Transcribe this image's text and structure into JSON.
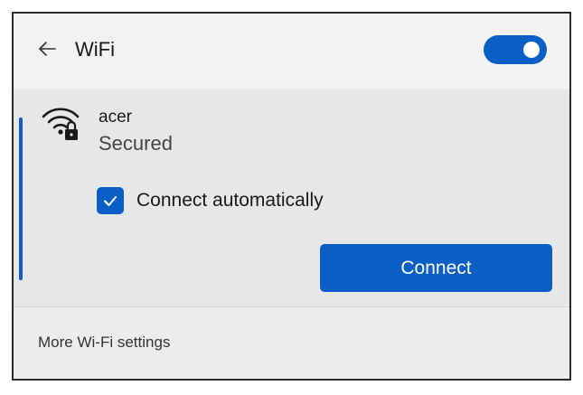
{
  "header": {
    "back_icon": "arrow-left-icon",
    "title": "WiFi",
    "wifi_toggle": {
      "state": "on",
      "color": "#0a5fc7"
    }
  },
  "network": {
    "icon": "wifi-secured-icon",
    "name": "acer",
    "status": "Secured",
    "connect_automatically": {
      "label": "Connect automatically",
      "checked": true
    },
    "connect_button_label": "Connect"
  },
  "footer": {
    "more_settings_label": "More Wi-Fi settings"
  },
  "colors": {
    "accent": "#0a5fc7",
    "panel_background": "#e7e7e7",
    "header_background": "#f2f2f2"
  }
}
